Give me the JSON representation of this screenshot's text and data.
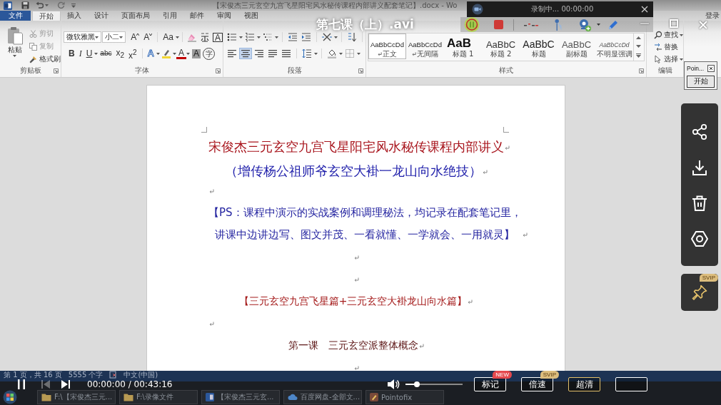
{
  "word": {
    "title": "【宋俊杰三元玄空九宫飞星阳宅风水秘传课程内部讲义配套笔记】.docx - Wo",
    "tabs": [
      {
        "label": "文件",
        "kind": "file",
        "selected": false
      },
      {
        "label": "开始",
        "kind": "tab",
        "selected": true
      },
      {
        "label": "插入",
        "kind": "tab",
        "selected": false
      },
      {
        "label": "设计",
        "kind": "tab",
        "selected": false
      },
      {
        "label": "页面布局",
        "kind": "tab",
        "selected": false
      },
      {
        "label": "引用",
        "kind": "tab",
        "selected": false
      },
      {
        "label": "邮件",
        "kind": "tab",
        "selected": false
      },
      {
        "label": "审阅",
        "kind": "tab",
        "selected": false
      },
      {
        "label": "视图",
        "kind": "tab",
        "selected": false
      }
    ],
    "sign_in": "登录",
    "ribbon": {
      "clipboard": {
        "label": "剪贴板",
        "paste": "粘贴",
        "cut": {
          "label": "剪切",
          "disabled": true
        },
        "copy": {
          "label": "复制",
          "disabled": true
        },
        "format_painter": {
          "label": "格式刷",
          "disabled": false
        }
      },
      "font": {
        "label": "字体",
        "font_name": "微软雅黑",
        "font_size": "小二",
        "grow": "A",
        "shrink": "A",
        "change_case": "Aa",
        "character_border": "A",
        "bold": "B",
        "italic": "I",
        "underline": "U",
        "strikethrough": "abc",
        "subscript": "x$_{2}$",
        "superscript": "x$^{2}$",
        "text_effects": "A",
        "font_color": "A",
        "character_shading": "A",
        "enclose": "字"
      },
      "paragraph": {
        "label": "段落",
        "alignments": [
          {
            "selected": false
          },
          {
            "selected": true
          },
          {
            "selected": false
          },
          {
            "selected": false
          },
          {
            "selected": false
          }
        ]
      },
      "styles": {
        "label": "样式",
        "items": [
          {
            "preview": "AaBbCcDd",
            "name": "正文",
            "kind": "normal",
            "mark": true,
            "selected": true
          },
          {
            "preview": "AaBbCcDd",
            "name": "无间隔",
            "kind": "normal",
            "mark": true,
            "selected": false
          },
          {
            "preview": "AaB",
            "name": "标题 1",
            "kind": "heading1",
            "mark": false,
            "selected": false
          },
          {
            "preview": "AaBbC",
            "name": "标题 2",
            "kind": "heading2",
            "mark": false,
            "selected": false
          },
          {
            "preview": "AaBbC",
            "name": "标题",
            "kind": "title",
            "mark": false,
            "selected": false
          },
          {
            "preview": "AaBbC",
            "name": "副标题",
            "kind": "subtitle",
            "mark": false,
            "selected": false
          },
          {
            "preview": "AaBbCcDd",
            "name": "不明显强调",
            "kind": "emphasis",
            "mark": false,
            "selected": false
          }
        ]
      },
      "editing": {
        "label": "编辑",
        "find": "查找",
        "replace": "替换",
        "select": "选择"
      }
    },
    "document": {
      "paragraphs": [
        {
          "kind": "title",
          "lines": [
            "宋俊杰三元玄空九宫飞星阳宅风水秘传课程内部讲义"
          ]
        },
        {
          "kind": "subtitle",
          "lines": [
            "（增传杨公祖师爷玄空大褂一龙山向水绝技）"
          ]
        },
        {
          "kind": "blank",
          "centered": false
        },
        {
          "kind": "note",
          "lines": [
            "【PS：课程中演示的实战案例和调理秘法，均记录在配套笔记里，",
            "讲课中边讲边写、图文并茂、一看就懂、一学就会、一用就灵】"
          ]
        },
        {
          "kind": "blank",
          "centered": true
        },
        {
          "kind": "blank",
          "centered": true
        },
        {
          "kind": "section",
          "lines": [
            "【三元玄空九宫飞星篇+三元玄空大褂龙山向水篇】"
          ]
        },
        {
          "kind": "blank",
          "centered": false
        },
        {
          "kind": "lesson",
          "lines": [
            "第一课　三元玄空派整体概念"
          ]
        },
        {
          "kind": "blank",
          "centered": true
        }
      ]
    },
    "status_bar": {
      "page": "第 1 页，共 16 页",
      "words": "5555 个字",
      "language": "中文(中国)"
    }
  },
  "taskbar": {
    "items": [
      {
        "label": "F:\\【宋俊杰三元...",
        "kind": "folder"
      },
      {
        "label": "F:\\录像文件",
        "kind": "folder"
      },
      {
        "label": "【宋俊杰三元玄...",
        "kind": "document"
      },
      {
        "label": "百度网盘-全部文...",
        "kind": "cloud"
      },
      {
        "label": "Pointofix",
        "kind": "app"
      }
    ]
  },
  "recorder": {
    "status": "录制中... 00:00:00"
  },
  "pointofix": {
    "title": "Poin...",
    "button": "开始"
  },
  "player": {
    "title": "第七课（上）.avi",
    "previous": {
      "disabled": true
    },
    "time": "00:00:00 / 00:43:16",
    "volume": {
      "level": 0.2
    },
    "buttons": [
      {
        "label": "标记",
        "kind": "mark",
        "badge": {
          "text": "NEW",
          "kind": "new"
        }
      },
      {
        "label": "倍速",
        "kind": "speed",
        "badge": {
          "text": "SVIP",
          "kind": "vip"
        }
      },
      {
        "label": "超清",
        "kind": "quality"
      },
      {
        "kind": "plain"
      }
    ],
    "pin_badge": "SVIP"
  }
}
